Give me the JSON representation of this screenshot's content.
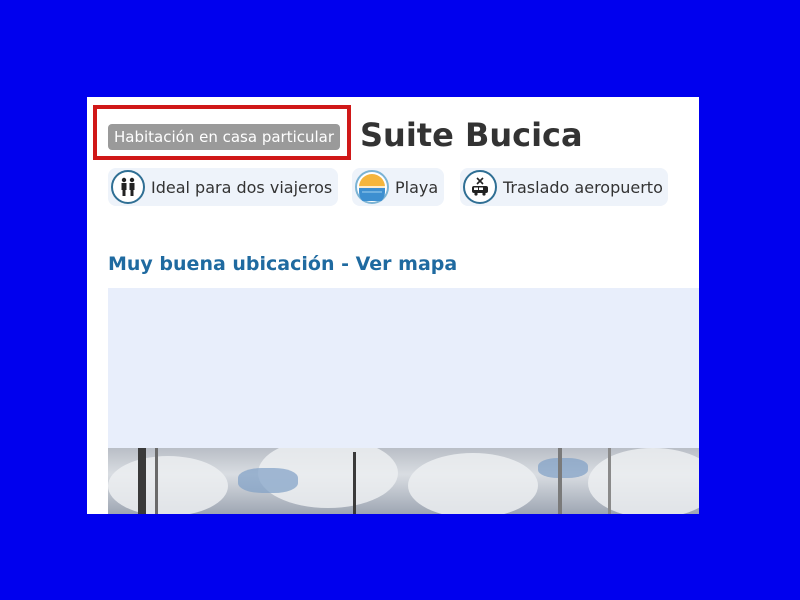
{
  "listing": {
    "type_badge": "Habitación en casa particular",
    "title": "Suite Bucica"
  },
  "features": [
    {
      "icon": "two-travelers-icon",
      "label": "Ideal para dos viajeros"
    },
    {
      "icon": "beach-icon",
      "label": "Playa"
    },
    {
      "icon": "airport-transfer-icon",
      "label": "Traslado aeropuerto"
    }
  ],
  "location": {
    "link_text": "Muy buena ubicación - Ver mapa"
  },
  "colors": {
    "background": "#0000ee",
    "highlight": "#d01818",
    "link": "#1f6aa0",
    "badge": "#9a9a9a"
  }
}
